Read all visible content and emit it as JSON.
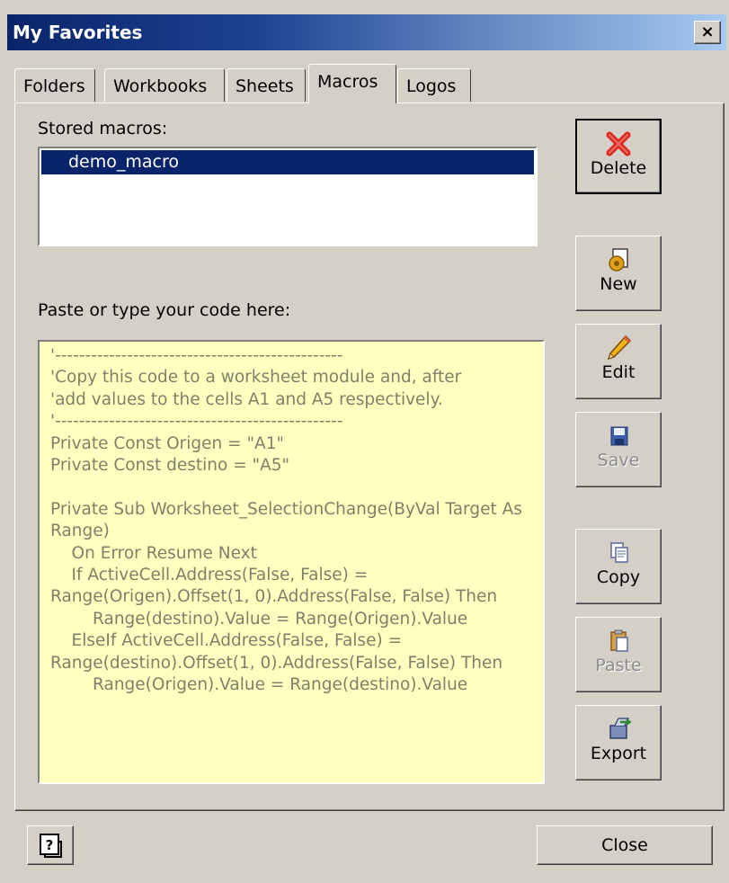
{
  "window": {
    "title": "My Favorites",
    "close_glyph": "×"
  },
  "tabs": [
    {
      "label": "Folders"
    },
    {
      "label": "Workbooks"
    },
    {
      "label": "Sheets"
    },
    {
      "label": "Macros",
      "active": true
    },
    {
      "label": "Logos"
    }
  ],
  "stored": {
    "label": "Stored macros:",
    "items": [
      "demo_macro"
    ],
    "selected": "demo_macro"
  },
  "editor": {
    "label": "Paste or type your code here:",
    "code": "'------------------------------------------------\n'Copy this code to a worksheet module and, after\n'add values to the cells A1 and A5 respectively.\n'------------------------------------------------\nPrivate Const Origen = \"A1\"\nPrivate Const destino = \"A5\"\n\nPrivate Sub Worksheet_SelectionChange(ByVal Target As Range)\n    On Error Resume Next\n    If ActiveCell.Address(False, False) = Range(Origen).Offset(1, 0).Address(False, False) Then\n        Range(destino).Value = Range(Origen).Value\n    ElseIf ActiveCell.Address(False, False) = Range(destino).Offset(1, 0).Address(False, False) Then\n        Range(Origen).Value = Range(destino).Value"
  },
  "buttons": {
    "delete": {
      "label": "Delete",
      "icon": "red-x-icon",
      "enabled": true
    },
    "new": {
      "label": "New",
      "icon": "new-macro-icon",
      "enabled": true
    },
    "edit": {
      "label": "Edit",
      "icon": "pencil-icon",
      "enabled": true
    },
    "save": {
      "label": "Save",
      "icon": "floppy-disk-icon",
      "enabled": false
    },
    "copy": {
      "label": "Copy",
      "icon": "copy-icon",
      "enabled": true
    },
    "paste": {
      "label": "Paste",
      "icon": "paste-icon",
      "enabled": false
    },
    "export": {
      "label": "Export",
      "icon": "export-icon",
      "enabled": true
    }
  },
  "footer": {
    "help_glyph": "?",
    "close_label": "Close"
  }
}
